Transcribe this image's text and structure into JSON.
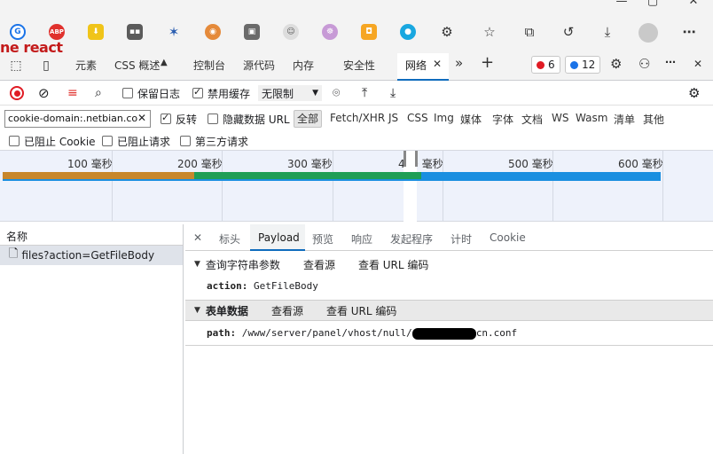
{
  "overlay_text": "ne react",
  "devtools_tabs": [
    "元素",
    "CSS 概述",
    "控制台",
    "源代码",
    "内存",
    "安全性",
    "网络"
  ],
  "badges": {
    "errors": "6",
    "messages": "12"
  },
  "toolbar": {
    "preserve_log": "保留日志",
    "disable_cache": "禁用缓存",
    "throttle": "无限制"
  },
  "filter": {
    "value": "cookie-domain:.netbian.co",
    "invert": "反转",
    "hide_data_url": "隐藏数据 URL",
    "all": "全部",
    "types": [
      "Fetch/XHR",
      "JS",
      "CSS",
      "Img",
      "媒体",
      "字体",
      "文档",
      "WS",
      "Wasm",
      "清单",
      "其他"
    ]
  },
  "block_filters": [
    "已阻止 Cookie",
    "已阻止请求",
    "第三方请求"
  ],
  "timeline_ticks": [
    "100 毫秒",
    "200 毫秒",
    "300 毫秒",
    "400 毫秒",
    "500 毫秒",
    "600 毫秒"
  ],
  "request_list": {
    "header": "名称",
    "rows": [
      "files?action=GetFileBody"
    ]
  },
  "detail_tabs": [
    "标头",
    "Payload",
    "预览",
    "响应",
    "发起程序",
    "计时",
    "Cookie"
  ],
  "payload": {
    "query_section": {
      "title": "查询字符串参数",
      "view_source": "查看源",
      "view_url_encoded": "查看 URL 编码",
      "key": "action:",
      "value": "GetFileBody"
    },
    "form_section": {
      "title": "表单数据",
      "view_source": "查看源",
      "view_url_encoded": "查看 URL 编码",
      "key": "path:",
      "value_prefix": "/www/server/panel/vhost/null/",
      "value_suffix": "cn.conf"
    }
  },
  "colors": {
    "accent": "#0f6cbd",
    "bar_orange": "#c8872b",
    "bar_green": "#1f9e55",
    "bar_blue": "#1a8fe0",
    "record_red": "#e01b24"
  }
}
